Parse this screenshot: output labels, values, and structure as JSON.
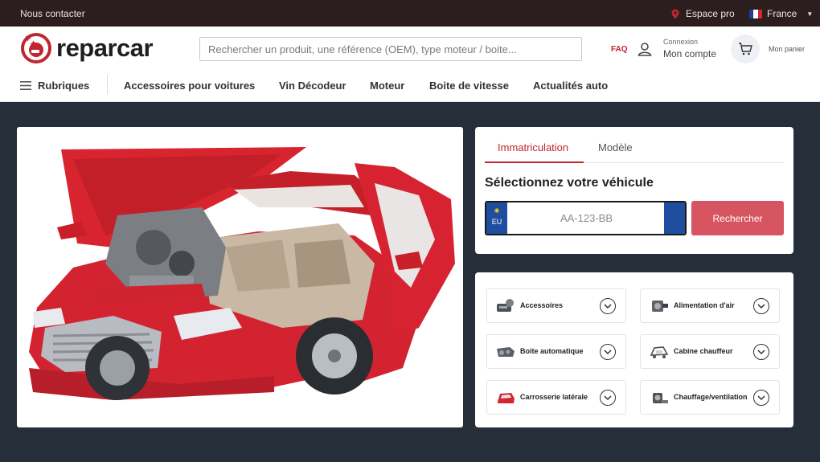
{
  "topbar": {
    "contact": "Nous contacter",
    "espace_pro": "Espace pro",
    "language": "France"
  },
  "header": {
    "brand": "reparcar",
    "search_placeholder": "Rechercher un produit, une référence (OEM), type moteur / boite...",
    "faq": "FAQ",
    "account_small": "Connexion",
    "account_big": "Mon compte",
    "cart": "Mon panier"
  },
  "nav": {
    "rubriques": "Rubriques",
    "items": [
      "Accessoires pour voitures",
      "Vin Décodeur",
      "Moteur",
      "Boite de vitesse",
      "Actualités auto"
    ]
  },
  "vehicle": {
    "tabs": [
      "Immatriculation",
      "Modèle"
    ],
    "title": "Sélectionnez votre véhicule",
    "plate_country": "EU",
    "plate_placeholder": "AA-123-BB",
    "search_button": "Rechercher"
  },
  "categories": [
    {
      "label": "Accessoires",
      "icon": "accessories-icon"
    },
    {
      "label": "Alimentation d'air",
      "icon": "air-intake-icon"
    },
    {
      "label": "Boite automatique",
      "icon": "gearbox-icon"
    },
    {
      "label": "Cabine chauffeur",
      "icon": "cabin-icon"
    },
    {
      "label": "Carrosserie latérale",
      "icon": "car-door-icon"
    },
    {
      "label": "Chauffage/ventilation",
      "icon": "heater-icon"
    }
  ],
  "colors": {
    "brand_red": "#c0262f",
    "button_red": "#d65561",
    "topbar": "#2c1d1f",
    "page_bg": "#262e3a"
  }
}
